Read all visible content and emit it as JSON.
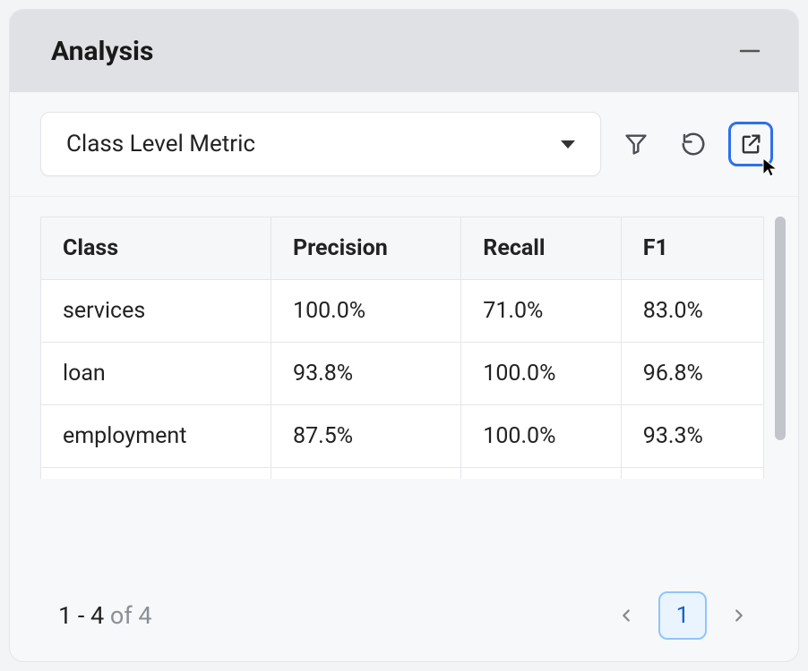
{
  "panel": {
    "title": "Analysis"
  },
  "toolbar": {
    "select_label": "Class Level Metric"
  },
  "table": {
    "columns": [
      "Class",
      "Precision",
      "Recall",
      "F1"
    ],
    "rows": [
      {
        "class": "services",
        "precision": "100.0%",
        "recall": "71.0%",
        "f1": "83.0%"
      },
      {
        "class": "loan",
        "precision": "93.8%",
        "recall": "100.0%",
        "f1": "96.8%"
      },
      {
        "class": "employment",
        "precision": "87.5%",
        "recall": "100.0%",
        "f1": "93.3%"
      }
    ]
  },
  "pager": {
    "range": "1 - 4",
    "of_word": "of",
    "total": "4",
    "current": "1"
  }
}
